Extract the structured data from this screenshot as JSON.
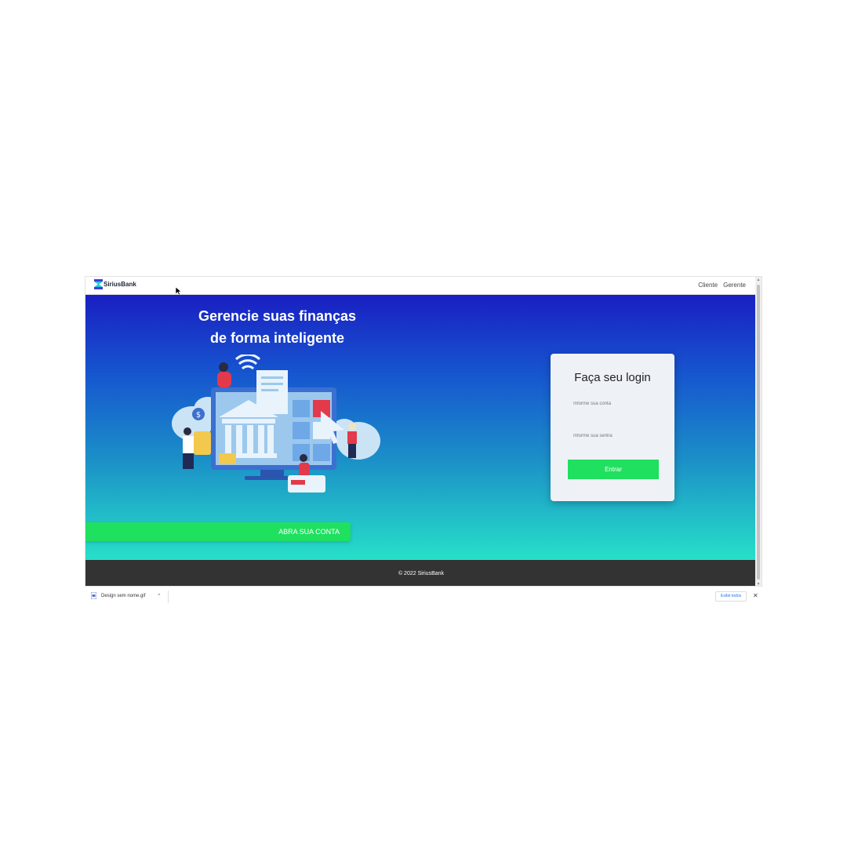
{
  "header": {
    "brand_name": "SiriusBank",
    "nav": [
      "Cliente",
      "Gerente"
    ]
  },
  "hero": {
    "title_line1": "Gerencie suas finanças",
    "title_line2": "de forma inteligente",
    "cta_label": "ABRA SUA CONTA"
  },
  "login": {
    "title": "Faça seu login",
    "account_placeholder": "Informe sua conta",
    "password_placeholder": "Informe sua senha",
    "submit_label": "Entrar"
  },
  "footer": {
    "copyright": "© 2022 SiriusBank"
  },
  "download_bar": {
    "file_name": "Design sem nome.gif",
    "show_all_label": "Exibir todos",
    "close_label": "✕"
  },
  "colors": {
    "accent_green": "#1fe05f",
    "hero_top": "#1a1fc2",
    "hero_bottom": "#27e0c8",
    "footer_bg": "#333333"
  }
}
